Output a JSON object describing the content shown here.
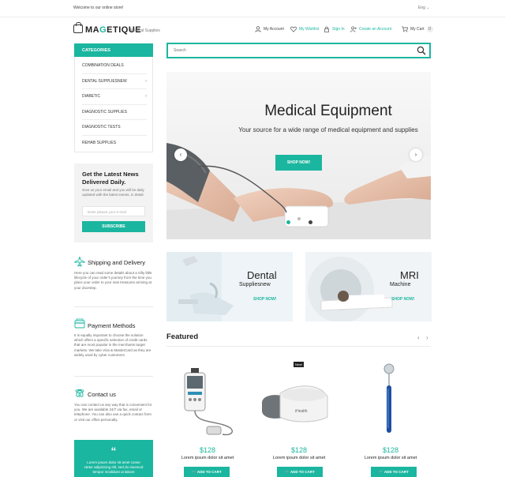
{
  "topbar": {
    "welcome": "Welcome to our online store!",
    "language": "Eng"
  },
  "header": {
    "logo_pre": "MA",
    "logo_accent": "G",
    "logo_post": "ETIQUE",
    "tagline": "Medical Supplies",
    "links": {
      "account": "My Account",
      "wishlist": "My Wishlist",
      "signin": "Sign In",
      "create": "Create an Account",
      "cart": "My Cart",
      "cart_count": "0"
    }
  },
  "categories": {
    "title": "CATEGORIES",
    "items": [
      {
        "label": "COMBINATION DEALS",
        "has_children": false
      },
      {
        "label": "DENTAL SUPPLIESNEW",
        "has_children": true
      },
      {
        "label": "DIABETIC",
        "has_children": true
      },
      {
        "label": "DIAGNOSTIC SUPPLIES",
        "has_children": false
      },
      {
        "label": "DIAGNOSTIC TESTS",
        "has_children": false
      },
      {
        "label": "REHAB SUPPLIES",
        "has_children": false
      }
    ]
  },
  "newsletter": {
    "title": "Get the Latest News Delivered Daily.",
    "text": "Give us your email and you will be daily updated with the latest events, in detail.",
    "placeholder": "Enter please your e-mail",
    "button": "SUBSCRIBE"
  },
  "info": [
    {
      "icon": "airplane-icon",
      "title": "Shipping and Delivery",
      "text": "Here you can read some details about a nifty little lifecycle of your order's journey from the time you place your order to your new treasures arriving at your doorstep."
    },
    {
      "icon": "payment-icon",
      "title": "Payment Methods",
      "text": "It is equally important to choose the solution which offers a specific selection of credit cards that are most popular in the merchants target markets. We take Visa & MasterCard as they are widely used by cyber customers."
    },
    {
      "icon": "phone-icon",
      "title": "Contact us",
      "text": "You can contact us any way that is convenient for you. We are available 24/7 via fax, email or telephone. You can also use a quick contact form or visit our office personally."
    }
  ],
  "testimonial": {
    "quote_mark": "“",
    "text": "Lorem ipsum dolor sit amet conse ctetur adipisicing elit, sed do eiusmod tempor incididunt ut labore"
  },
  "search": {
    "placeholder": "Search"
  },
  "hero": {
    "title": "Medical Equipment",
    "subtitle": "Your source for a wide range of medical equipment and supplies",
    "button": "SHOP NOW!",
    "prev": "‹",
    "next": "›",
    "active_slide": 0
  },
  "banners": [
    {
      "title": "Dental",
      "subtitle": "Suppliesnew",
      "link": "SHOP NOW!"
    },
    {
      "title": "MRI",
      "subtitle": "Machine",
      "link": "SHOP NOW!"
    }
  ],
  "featured": {
    "title": "Featured",
    "prev": "‹",
    "next": "›",
    "badge": "New!",
    "products": [
      {
        "price": "$128",
        "name": "Lorem ipsum dolor sit amet",
        "button": "ADD TO CART"
      },
      {
        "price": "$128",
        "name": "Lorem ipsum dolor sit amet",
        "button": "ADD TO CART"
      },
      {
        "price": "$128",
        "name": "Lorem ipsum dolor sit amet",
        "button": "ADD TO CART"
      }
    ],
    "product_label": "iHealth"
  },
  "colors": {
    "accent": "#1bb69f",
    "text": "#222222"
  }
}
